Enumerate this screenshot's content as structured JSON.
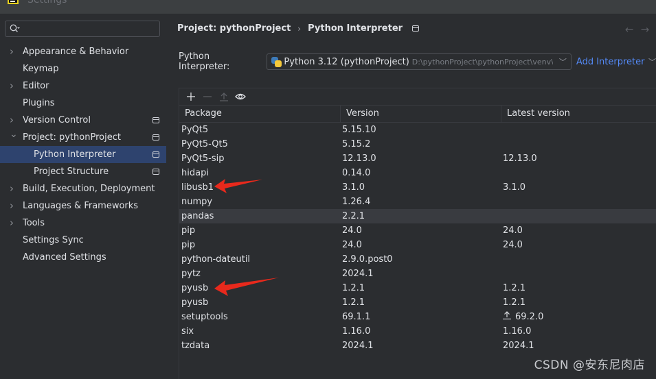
{
  "window": {
    "title": "Settings"
  },
  "sidebar": {
    "search": {
      "placeholder": "",
      "value": ""
    },
    "items": [
      {
        "label": "Appearance & Behavior",
        "expandable": true,
        "expanded": false,
        "level": 0,
        "project_scoped": false
      },
      {
        "label": "Keymap",
        "expandable": false,
        "level": 0,
        "project_scoped": false
      },
      {
        "label": "Editor",
        "expandable": true,
        "expanded": false,
        "level": 0,
        "project_scoped": false
      },
      {
        "label": "Plugins",
        "expandable": false,
        "level": 0,
        "project_scoped": false
      },
      {
        "label": "Version Control",
        "expandable": true,
        "expanded": false,
        "level": 0,
        "project_scoped": true
      },
      {
        "label": "Project: pythonProject",
        "expandable": true,
        "expanded": true,
        "level": 0,
        "project_scoped": true
      },
      {
        "label": "Python Interpreter",
        "expandable": false,
        "level": 1,
        "project_scoped": true,
        "selected": true
      },
      {
        "label": "Project Structure",
        "expandable": false,
        "level": 1,
        "project_scoped": true
      },
      {
        "label": "Build, Execution, Deployment",
        "expandable": true,
        "expanded": false,
        "level": 0,
        "project_scoped": false
      },
      {
        "label": "Languages & Frameworks",
        "expandable": true,
        "expanded": false,
        "level": 0,
        "project_scoped": false
      },
      {
        "label": "Tools",
        "expandable": true,
        "expanded": false,
        "level": 0,
        "project_scoped": false
      },
      {
        "label": "Settings Sync",
        "expandable": false,
        "level": 0,
        "project_scoped": false
      },
      {
        "label": "Advanced Settings",
        "expandable": false,
        "level": 0,
        "project_scoped": false
      }
    ]
  },
  "main": {
    "breadcrumb": [
      "Project: pythonProject",
      "Python Interpreter"
    ],
    "nav_back": "←",
    "nav_forward": "→",
    "interpreter": {
      "label": "Python Interpreter:",
      "name": "Python 3.12 (pythonProject)",
      "path": "D:\\pythonProject\\pythonProject\\venv\\Scripts\\python.exe",
      "add_label": "Add Interpreter"
    },
    "toolbar": {
      "add": "+",
      "remove": "—",
      "upgrade": "↑",
      "show_early_releases": "eye"
    },
    "table": {
      "columns": [
        "Package",
        "Version",
        "Latest version"
      ],
      "rows": [
        {
          "package": "PyQt5",
          "version": "5.15.10",
          "latest": "",
          "upgrade": false
        },
        {
          "package": "PyQt5-Qt5",
          "version": "5.15.2",
          "latest": "",
          "upgrade": false
        },
        {
          "package": "PyQt5-sip",
          "version": "12.13.0",
          "latest": "12.13.0",
          "upgrade": false
        },
        {
          "package": "hidapi",
          "version": "0.14.0",
          "latest": "",
          "upgrade": false
        },
        {
          "package": "libusb1",
          "version": "3.1.0",
          "latest": "3.1.0",
          "upgrade": false,
          "annotated": true
        },
        {
          "package": "numpy",
          "version": "1.26.4",
          "latest": "",
          "upgrade": false
        },
        {
          "package": "pandas",
          "version": "2.2.1",
          "latest": "",
          "upgrade": false,
          "hover": true
        },
        {
          "package": "pip",
          "version": "24.0",
          "latest": "24.0",
          "upgrade": false
        },
        {
          "package": "pip",
          "version": "24.0",
          "latest": "24.0",
          "upgrade": false
        },
        {
          "package": "python-dateutil",
          "version": "2.9.0.post0",
          "latest": "",
          "upgrade": false
        },
        {
          "package": "pytz",
          "version": "2024.1",
          "latest": "",
          "upgrade": false
        },
        {
          "package": "pyusb",
          "version": "1.2.1",
          "latest": "1.2.1",
          "upgrade": false,
          "annotated": true
        },
        {
          "package": "pyusb",
          "version": "1.2.1",
          "latest": "1.2.1",
          "upgrade": false
        },
        {
          "package": "setuptools",
          "version": "69.1.1",
          "latest": "69.2.0",
          "upgrade": true
        },
        {
          "package": "six",
          "version": "1.16.0",
          "latest": "1.16.0",
          "upgrade": false
        },
        {
          "package": "tzdata",
          "version": "2024.1",
          "latest": "2024.1",
          "upgrade": false
        }
      ]
    }
  },
  "annotations": {
    "arrow_color": "#e8291c",
    "targets": [
      "libusb1",
      "pyusb"
    ]
  },
  "watermark": "CSDN @安东尼肉店"
}
